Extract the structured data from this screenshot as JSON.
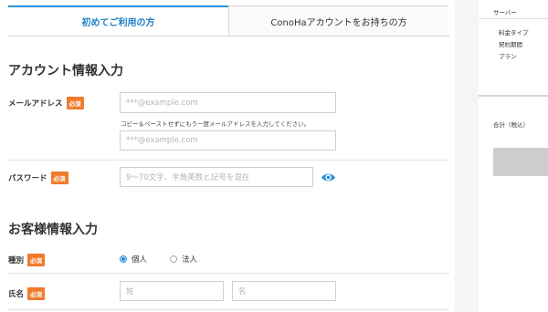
{
  "tabs": {
    "first_time": "初めてご利用の方",
    "conoha_account": "ConoHaアカウントをお持ちの方"
  },
  "account_section": {
    "title": "アカウント情報入力",
    "email_label": "メールアドレス",
    "email_placeholder": "***@example.com",
    "email_hint": "コピー＆ペーストせずにもう一度メールアドレスを入力してください。",
    "email_confirm_placeholder": "***@example.com",
    "password_label": "パスワード",
    "password_placeholder": "9〜70文字、半角英数と記号を混在"
  },
  "customer_section": {
    "title": "お客様情報入力",
    "type_label": "種別",
    "type_options": [
      "個人",
      "法人"
    ],
    "name_label": "氏名",
    "last_name_placeholder": "姓",
    "first_name_placeholder": "名"
  },
  "required_badge": "必須",
  "summary": {
    "server_label": "サーバー",
    "rate_type": "料金タイプ",
    "contract_period": "契約期間",
    "plan": "プラン",
    "total": "合計（税込）"
  },
  "colors": {
    "accent": "#2b90d9",
    "required": "#f07b2c"
  },
  "icons": {
    "password_toggle": "eye-icon"
  }
}
